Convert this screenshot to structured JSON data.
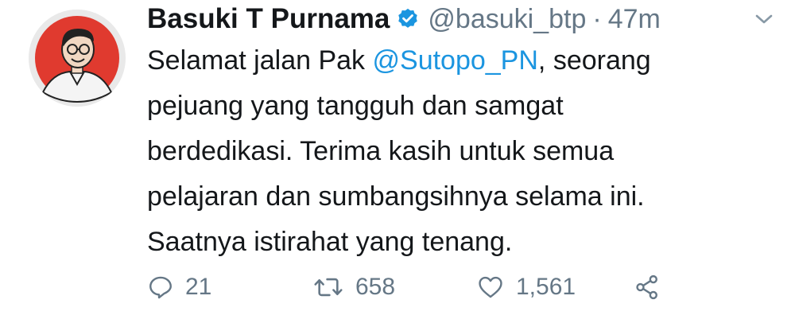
{
  "tweet": {
    "author_name": "Basuki T Purnama",
    "handle": "@basuki_btp",
    "separator": "·",
    "time": "47m",
    "verified": true,
    "text_lines": [
      {
        "before": "Selamat jalan Pak ",
        "mention": "@Sutopo_PN",
        "after": ", seorang"
      },
      {
        "text": "pejuang yang tangguh dan samgat"
      },
      {
        "text": "berdedikasi. Terima kasih untuk semua"
      },
      {
        "text": "pelajaran dan sumbangsihnya selama ini."
      },
      {
        "text": "Saatnya istirahat yang tenang."
      }
    ],
    "actions": {
      "reply_count": "21",
      "retweet_count": "658",
      "like_count": "1,561"
    }
  },
  "colors": {
    "accent": "#1b95e0",
    "text_primary": "#14171a",
    "text_secondary": "#657786",
    "avatar_bg": "#e03a2f"
  },
  "icons": {
    "verified": "verified-badge-icon",
    "caret": "chevron-down-icon",
    "reply": "reply-icon",
    "retweet": "retweet-icon",
    "like": "heart-icon",
    "share": "share-icon"
  }
}
